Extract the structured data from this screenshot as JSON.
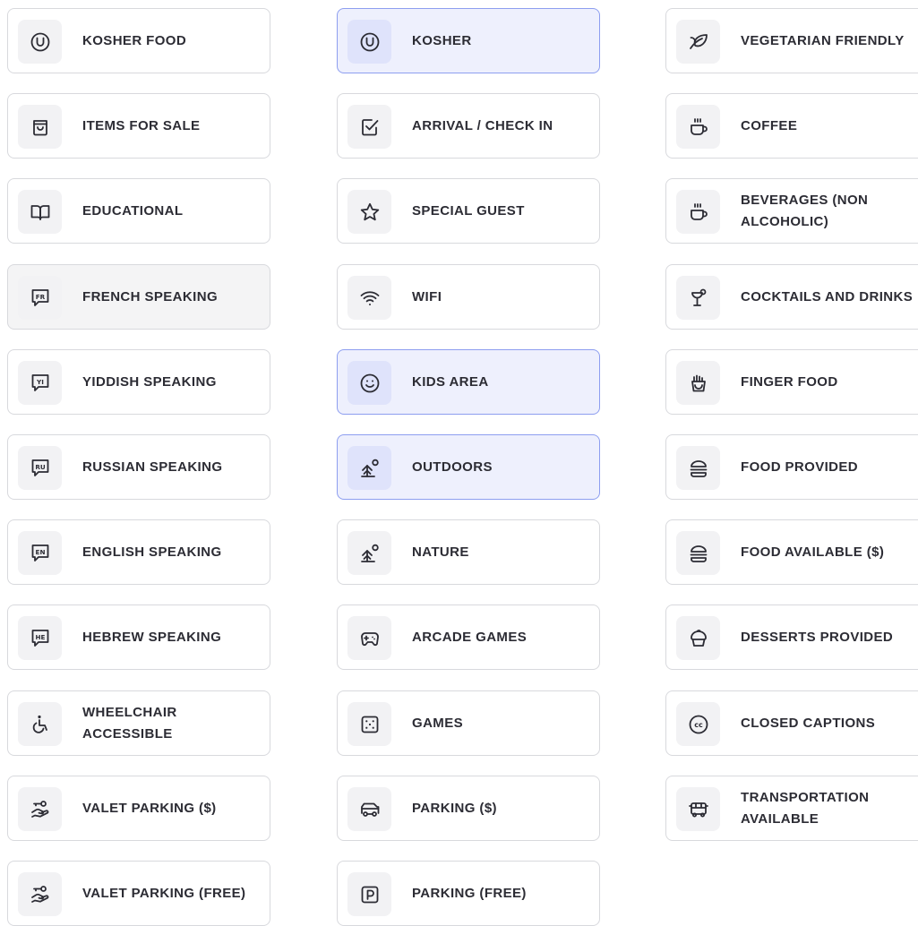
{
  "columns": [
    [
      {
        "label": "KOSHER FOOD",
        "icon": "kosher-icon",
        "state": "default"
      },
      {
        "label": "ITEMS FOR SALE",
        "icon": "shopping-bag-icon",
        "state": "default"
      },
      {
        "label": "EDUCATIONAL",
        "icon": "book-icon",
        "state": "default"
      },
      {
        "label": "FRENCH SPEAKING",
        "icon": "speech-fr-icon",
        "icon_text": "FR",
        "state": "hover"
      },
      {
        "label": "YIDDISH SPEAKING",
        "icon": "speech-yi-icon",
        "icon_text": "YI",
        "state": "default"
      },
      {
        "label": "RUSSIAN SPEAKING",
        "icon": "speech-ru-icon",
        "icon_text": "RU",
        "state": "default"
      },
      {
        "label": "ENGLISH SPEAKING",
        "icon": "speech-en-icon",
        "icon_text": "EN",
        "state": "default"
      },
      {
        "label": "HEBREW SPEAKING",
        "icon": "speech-he-icon",
        "icon_text": "HE",
        "state": "default"
      },
      {
        "label": "WHEELCHAIR ACCESSIBLE",
        "icon": "wheelchair-icon",
        "state": "default"
      },
      {
        "label": "VALET PARKING ($)",
        "icon": "valet-hand-key-icon",
        "state": "default"
      },
      {
        "label": "VALET PARKING (FREE)",
        "icon": "valet-hand-key-icon",
        "state": "default"
      }
    ],
    [
      {
        "label": "KOSHER",
        "icon": "kosher-icon",
        "state": "selected"
      },
      {
        "label": "ARRIVAL / CHECK IN",
        "icon": "checkbox-icon",
        "state": "default"
      },
      {
        "label": "SPECIAL GUEST",
        "icon": "star-icon",
        "state": "default"
      },
      {
        "label": "WIFI",
        "icon": "wifi-icon",
        "state": "default"
      },
      {
        "label": "KIDS AREA",
        "icon": "smiley-icon",
        "state": "selected"
      },
      {
        "label": "OUTDOORS",
        "icon": "tree-sun-icon",
        "state": "selected"
      },
      {
        "label": "NATURE",
        "icon": "tree-sun-icon",
        "state": "default"
      },
      {
        "label": "ARCADE GAMES",
        "icon": "gamepad-icon",
        "state": "default"
      },
      {
        "label": "GAMES",
        "icon": "dice-icon",
        "state": "default"
      },
      {
        "label": "PARKING ($)",
        "icon": "car-icon",
        "state": "default"
      },
      {
        "label": "PARKING (FREE)",
        "icon": "parking-icon",
        "state": "default"
      }
    ],
    [
      {
        "label": "VEGETARIAN FRIENDLY",
        "icon": "leaf-icon",
        "state": "default"
      },
      {
        "label": "COFFEE",
        "icon": "coffee-cup-icon",
        "state": "default"
      },
      {
        "label": "BEVERAGES (NON ALCOHOLIC)",
        "icon": "coffee-cup-icon",
        "state": "default"
      },
      {
        "label": "COCKTAILS AND DRINKS",
        "icon": "cocktail-glass-icon",
        "state": "default"
      },
      {
        "label": "FINGER FOOD",
        "icon": "fries-icon",
        "state": "default"
      },
      {
        "label": "FOOD PROVIDED",
        "icon": "burger-icon",
        "state": "default"
      },
      {
        "label": "FOOD AVAILABLE ($)",
        "icon": "burger-icon",
        "state": "default"
      },
      {
        "label": "DESSERTS PROVIDED",
        "icon": "cupcake-icon",
        "state": "default"
      },
      {
        "label": "CLOSED CAPTIONS",
        "icon": "cc-icon",
        "icon_text": "cc",
        "state": "default"
      },
      {
        "label": "TRANSPORTATION AVAILABLE",
        "icon": "bus-icon",
        "state": "default"
      }
    ]
  ],
  "colors": {
    "border": "#d8d9dd",
    "selected_bg": "#eef0fd",
    "selected_border": "#8d9ef0",
    "icon_bg": "#f2f2f4",
    "text": "#2c2c34",
    "icon_stroke": "#2c2c34"
  }
}
